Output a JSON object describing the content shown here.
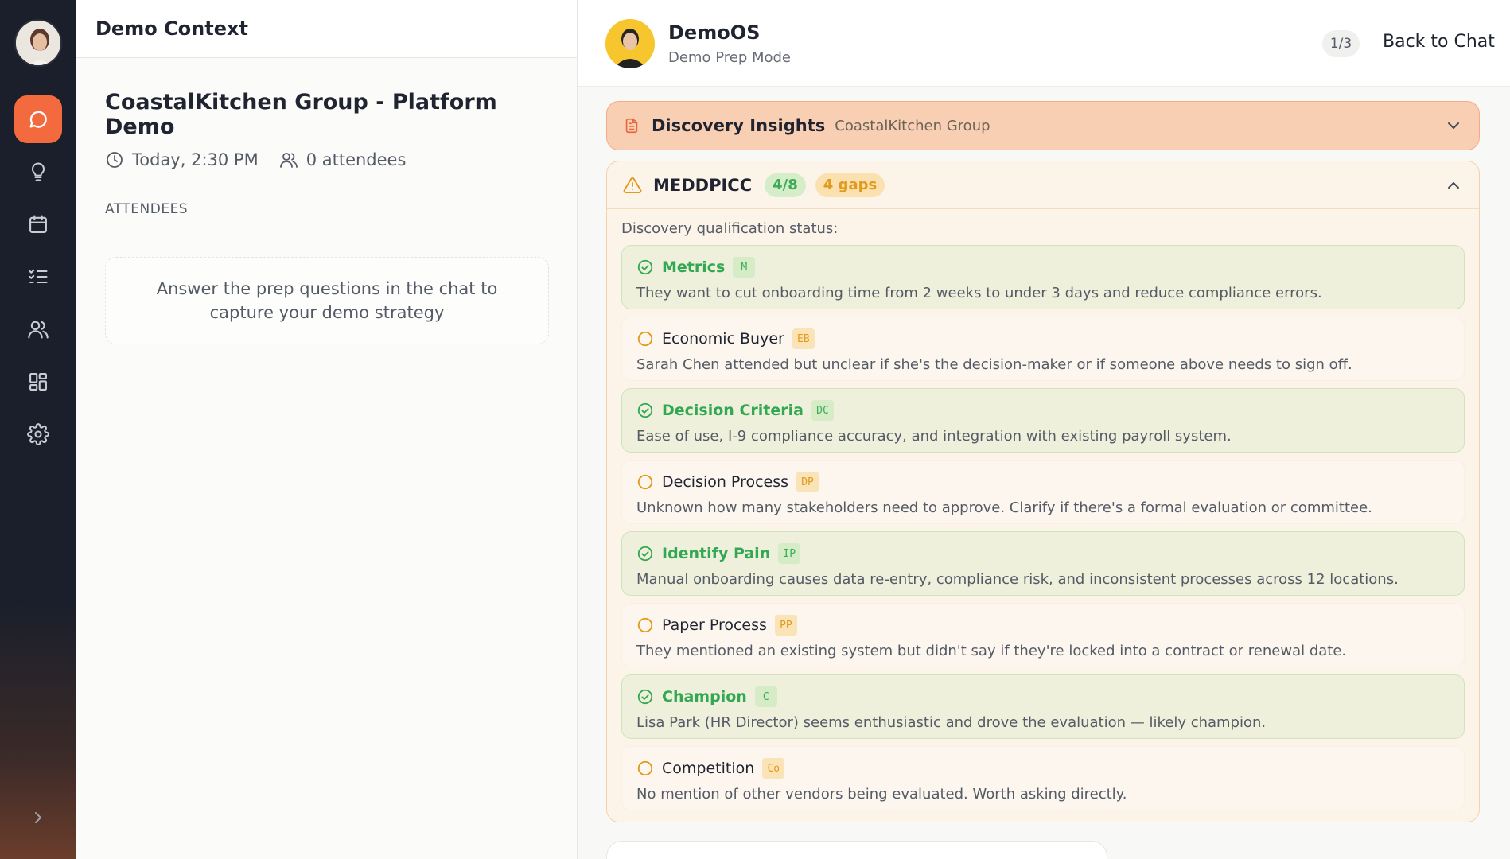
{
  "colors": {
    "accent": "#f36a3f",
    "success": "#33a852",
    "warning": "#e29a1c",
    "rail": "#1a1f2b"
  },
  "sidebar": {
    "items": [
      {
        "name": "chat",
        "icon": "chat-bubble-icon",
        "active": true
      },
      {
        "name": "insights",
        "icon": "lightbulb-icon",
        "active": false
      },
      {
        "name": "calendar",
        "icon": "calendar-icon",
        "active": false
      },
      {
        "name": "tasks",
        "icon": "checklist-icon",
        "active": false
      },
      {
        "name": "contacts",
        "icon": "users-icon",
        "active": false
      },
      {
        "name": "dashboard",
        "icon": "grid-icon",
        "active": false
      },
      {
        "name": "settings",
        "icon": "gear-icon",
        "active": false
      }
    ]
  },
  "context": {
    "header_title": "Demo Context",
    "demo_title": "CoastalKitchen Group - Platform Demo",
    "time": "Today, 2:30 PM",
    "attendees_count": "0 attendees",
    "attendees_label": "ATTENDEES",
    "empty_message": "Answer the prep questions in the chat to capture your demo strategy"
  },
  "main": {
    "bot_name": "DemoOS",
    "bot_mode": "Demo Prep Mode",
    "pager": "1/3",
    "back_label": "Back to Chat",
    "insights": {
      "title": "Discovery Insights",
      "subtitle": "CoastalKitchen Group"
    },
    "meddpicc": {
      "title": "MEDDPICC",
      "score": "4/8",
      "gaps": "4 gaps",
      "status_label": "Discovery qualification status:",
      "items": [
        {
          "name": "Metrics",
          "code": "M",
          "status": "ok",
          "desc": "They want to cut onboarding time from 2 weeks to under 3 days and reduce compliance errors."
        },
        {
          "name": "Economic Buyer",
          "code": "EB",
          "status": "gap",
          "desc": "Sarah Chen attended but unclear if she's the decision-maker or if someone above needs to sign off."
        },
        {
          "name": "Decision Criteria",
          "code": "DC",
          "status": "ok",
          "desc": "Ease of use, I-9 compliance accuracy, and integration with existing payroll system."
        },
        {
          "name": "Decision Process",
          "code": "DP",
          "status": "gap",
          "desc": "Unknown how many stakeholders need to approve. Clarify if there's a formal evaluation or committee."
        },
        {
          "name": "Identify Pain",
          "code": "IP",
          "status": "ok",
          "desc": "Manual onboarding causes data re-entry, compliance risk, and inconsistent processes across 12 locations."
        },
        {
          "name": "Paper Process",
          "code": "PP",
          "status": "gap",
          "desc": "They mentioned an existing system but didn't say if they're locked into a contract or renewal date."
        },
        {
          "name": "Champion",
          "code": "C",
          "status": "ok",
          "desc": "Lisa Park (HR Director) seems enthusiastic and drove the evaluation — likely champion."
        },
        {
          "name": "Competition",
          "code": "Co",
          "status": "gap",
          "desc": "No mention of other vendors being evaluated. Worth asking directly."
        }
      ]
    }
  }
}
